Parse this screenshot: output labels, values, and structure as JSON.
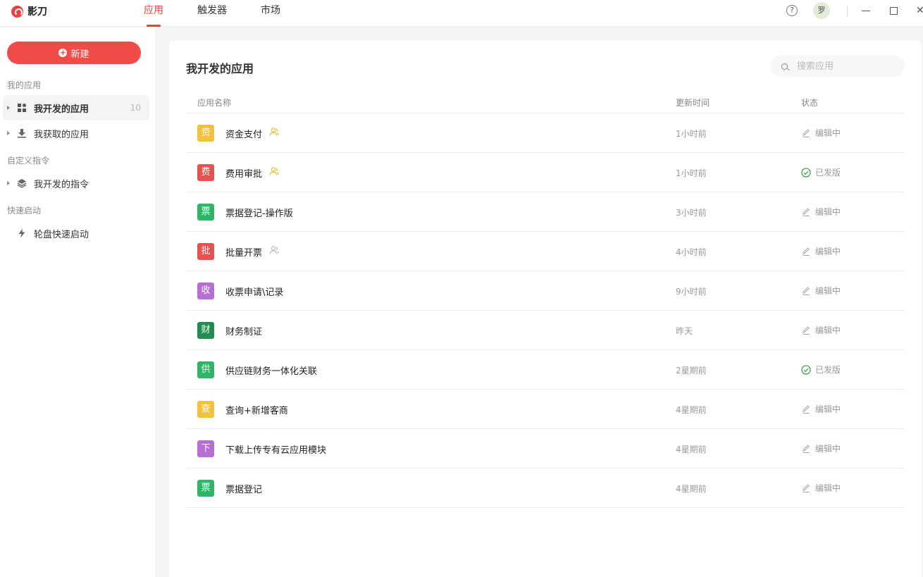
{
  "app": {
    "name": "影刀"
  },
  "tabs": [
    {
      "label": "应用",
      "active": true
    },
    {
      "label": "触发器",
      "active": false
    },
    {
      "label": "市场",
      "active": false
    }
  ],
  "topbar": {
    "help_symbol": "?",
    "avatar_text": "罗"
  },
  "sidebar": {
    "new_button": "新建",
    "sections": [
      {
        "title": "我的应用"
      },
      {
        "title": "自定义指令"
      },
      {
        "title": "快速启动"
      }
    ],
    "items": [
      {
        "label": "我开发的应用",
        "count": "10",
        "icon": "grid-icon",
        "active": true
      },
      {
        "label": "我获取的应用",
        "icon": "download-icon"
      },
      {
        "label": "我开发的指令",
        "icon": "layers-icon"
      },
      {
        "label": "轮盘快速启动",
        "icon": "lightning-icon"
      }
    ]
  },
  "main": {
    "title": "我开发的应用",
    "search_placeholder": "搜索应用",
    "columns": {
      "name": "应用名称",
      "updated": "更新时间",
      "status": "状态"
    },
    "rows": [
      {
        "icon_char": "资",
        "icon_color": "#f2c23e",
        "name": "资金支付",
        "shared": "yellow",
        "time": "1小时前",
        "status": "编辑中",
        "published": false
      },
      {
        "icon_char": "费",
        "icon_color": "#e5524f",
        "name": "费用审批",
        "shared": "yellow",
        "time": "1小时前",
        "status": "已发版",
        "published": true
      },
      {
        "icon_char": "票",
        "icon_color": "#2fb566",
        "name": "票据登记-操作版",
        "time": "3小时前",
        "status": "编辑中",
        "published": false
      },
      {
        "icon_char": "批",
        "icon_color": "#e5524f",
        "name": "批量开票",
        "shared": "gray",
        "time": "4小时前",
        "status": "编辑中",
        "published": false
      },
      {
        "icon_char": "收",
        "icon_color": "#b76fd6",
        "name": "收票申请\\记录",
        "time": "9小时前",
        "status": "编辑中",
        "published": false
      },
      {
        "icon_char": "财",
        "icon_color": "#1f8e4f",
        "name": "财务制证",
        "time": "昨天",
        "status": "编辑中",
        "published": false
      },
      {
        "icon_char": "供",
        "icon_color": "#2fb566",
        "name": "供应链财务一体化关联",
        "time": "2星期前",
        "status": "已发版",
        "published": true
      },
      {
        "icon_char": "查",
        "icon_color": "#f2c23e",
        "name": "查询+新增客商",
        "time": "4星期前",
        "status": "编辑中",
        "published": false
      },
      {
        "icon_char": "下",
        "icon_color": "#b76fd6",
        "name": "下载上传专有云应用模块",
        "time": "4星期前",
        "status": "编辑中",
        "published": false
      },
      {
        "icon_char": "票",
        "icon_color": "#2fb566",
        "name": "票据登记",
        "time": "4星期前",
        "status": "编辑中",
        "published": false
      }
    ]
  },
  "colors": {
    "accent": "#e8413f",
    "published": "#3aa74b",
    "shared_yellow": "#e9b930",
    "shared_gray": "#bbbbbb"
  }
}
